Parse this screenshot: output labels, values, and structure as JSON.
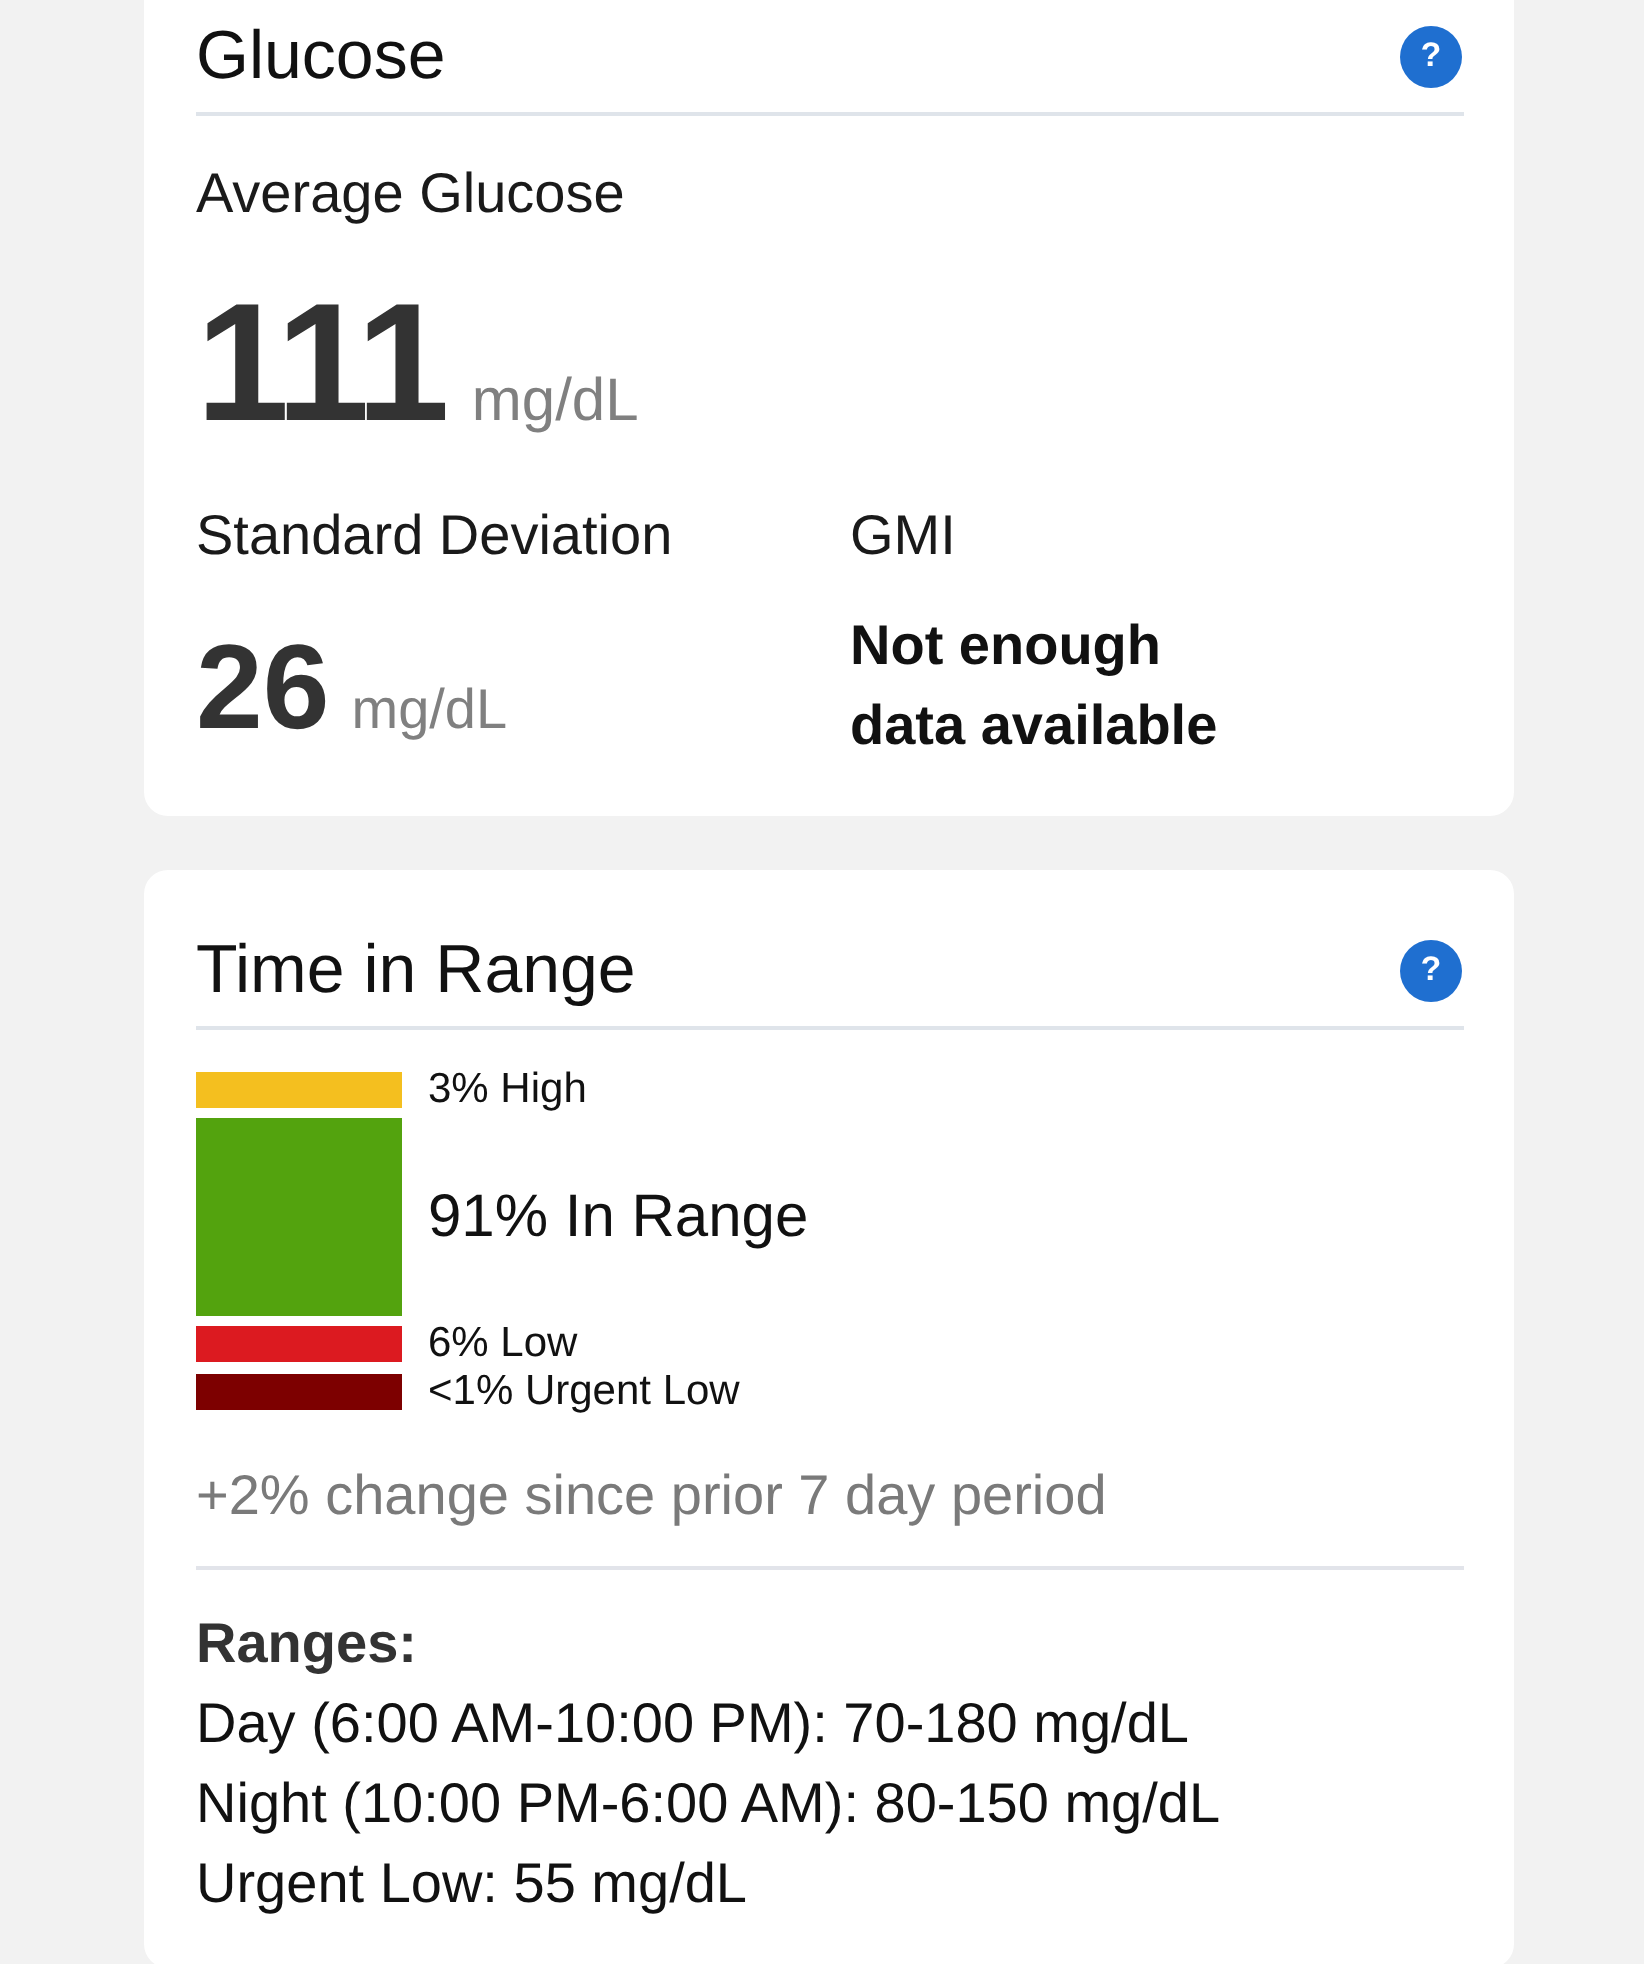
{
  "glucose": {
    "title": "Glucose",
    "help": "?",
    "average": {
      "label": "Average Glucose",
      "value": "111",
      "unit": "mg/dL"
    },
    "stats": [
      {
        "kind": "value",
        "label": "Standard Deviation",
        "value": "26",
        "unit": "mg/dL"
      },
      {
        "kind": "message",
        "label": "GMI",
        "message": "Not enough data available"
      }
    ]
  },
  "time_in_range": {
    "title": "Time in Range",
    "help": "?",
    "segments": [
      {
        "kind": "minor",
        "label": "3% High",
        "color": "#f4bf1f"
      },
      {
        "kind": "major",
        "label": "91% In Range",
        "color": "#53a30e"
      },
      {
        "kind": "minor",
        "label": "6% Low",
        "color": "#dc1a20"
      },
      {
        "kind": "minor",
        "label": "<1% Urgent Low",
        "color": "#7d0000"
      }
    ],
    "change": "+2% change since prior 7 day period",
    "ranges": {
      "heading": "Ranges:",
      "lines": [
        "Day (6:00 AM-10:00 PM): 70-180 mg/dL",
        "Night (10:00 PM-6:00 AM): 80-150 mg/dL",
        "Urgent Low: 55 mg/dL"
      ]
    }
  }
}
